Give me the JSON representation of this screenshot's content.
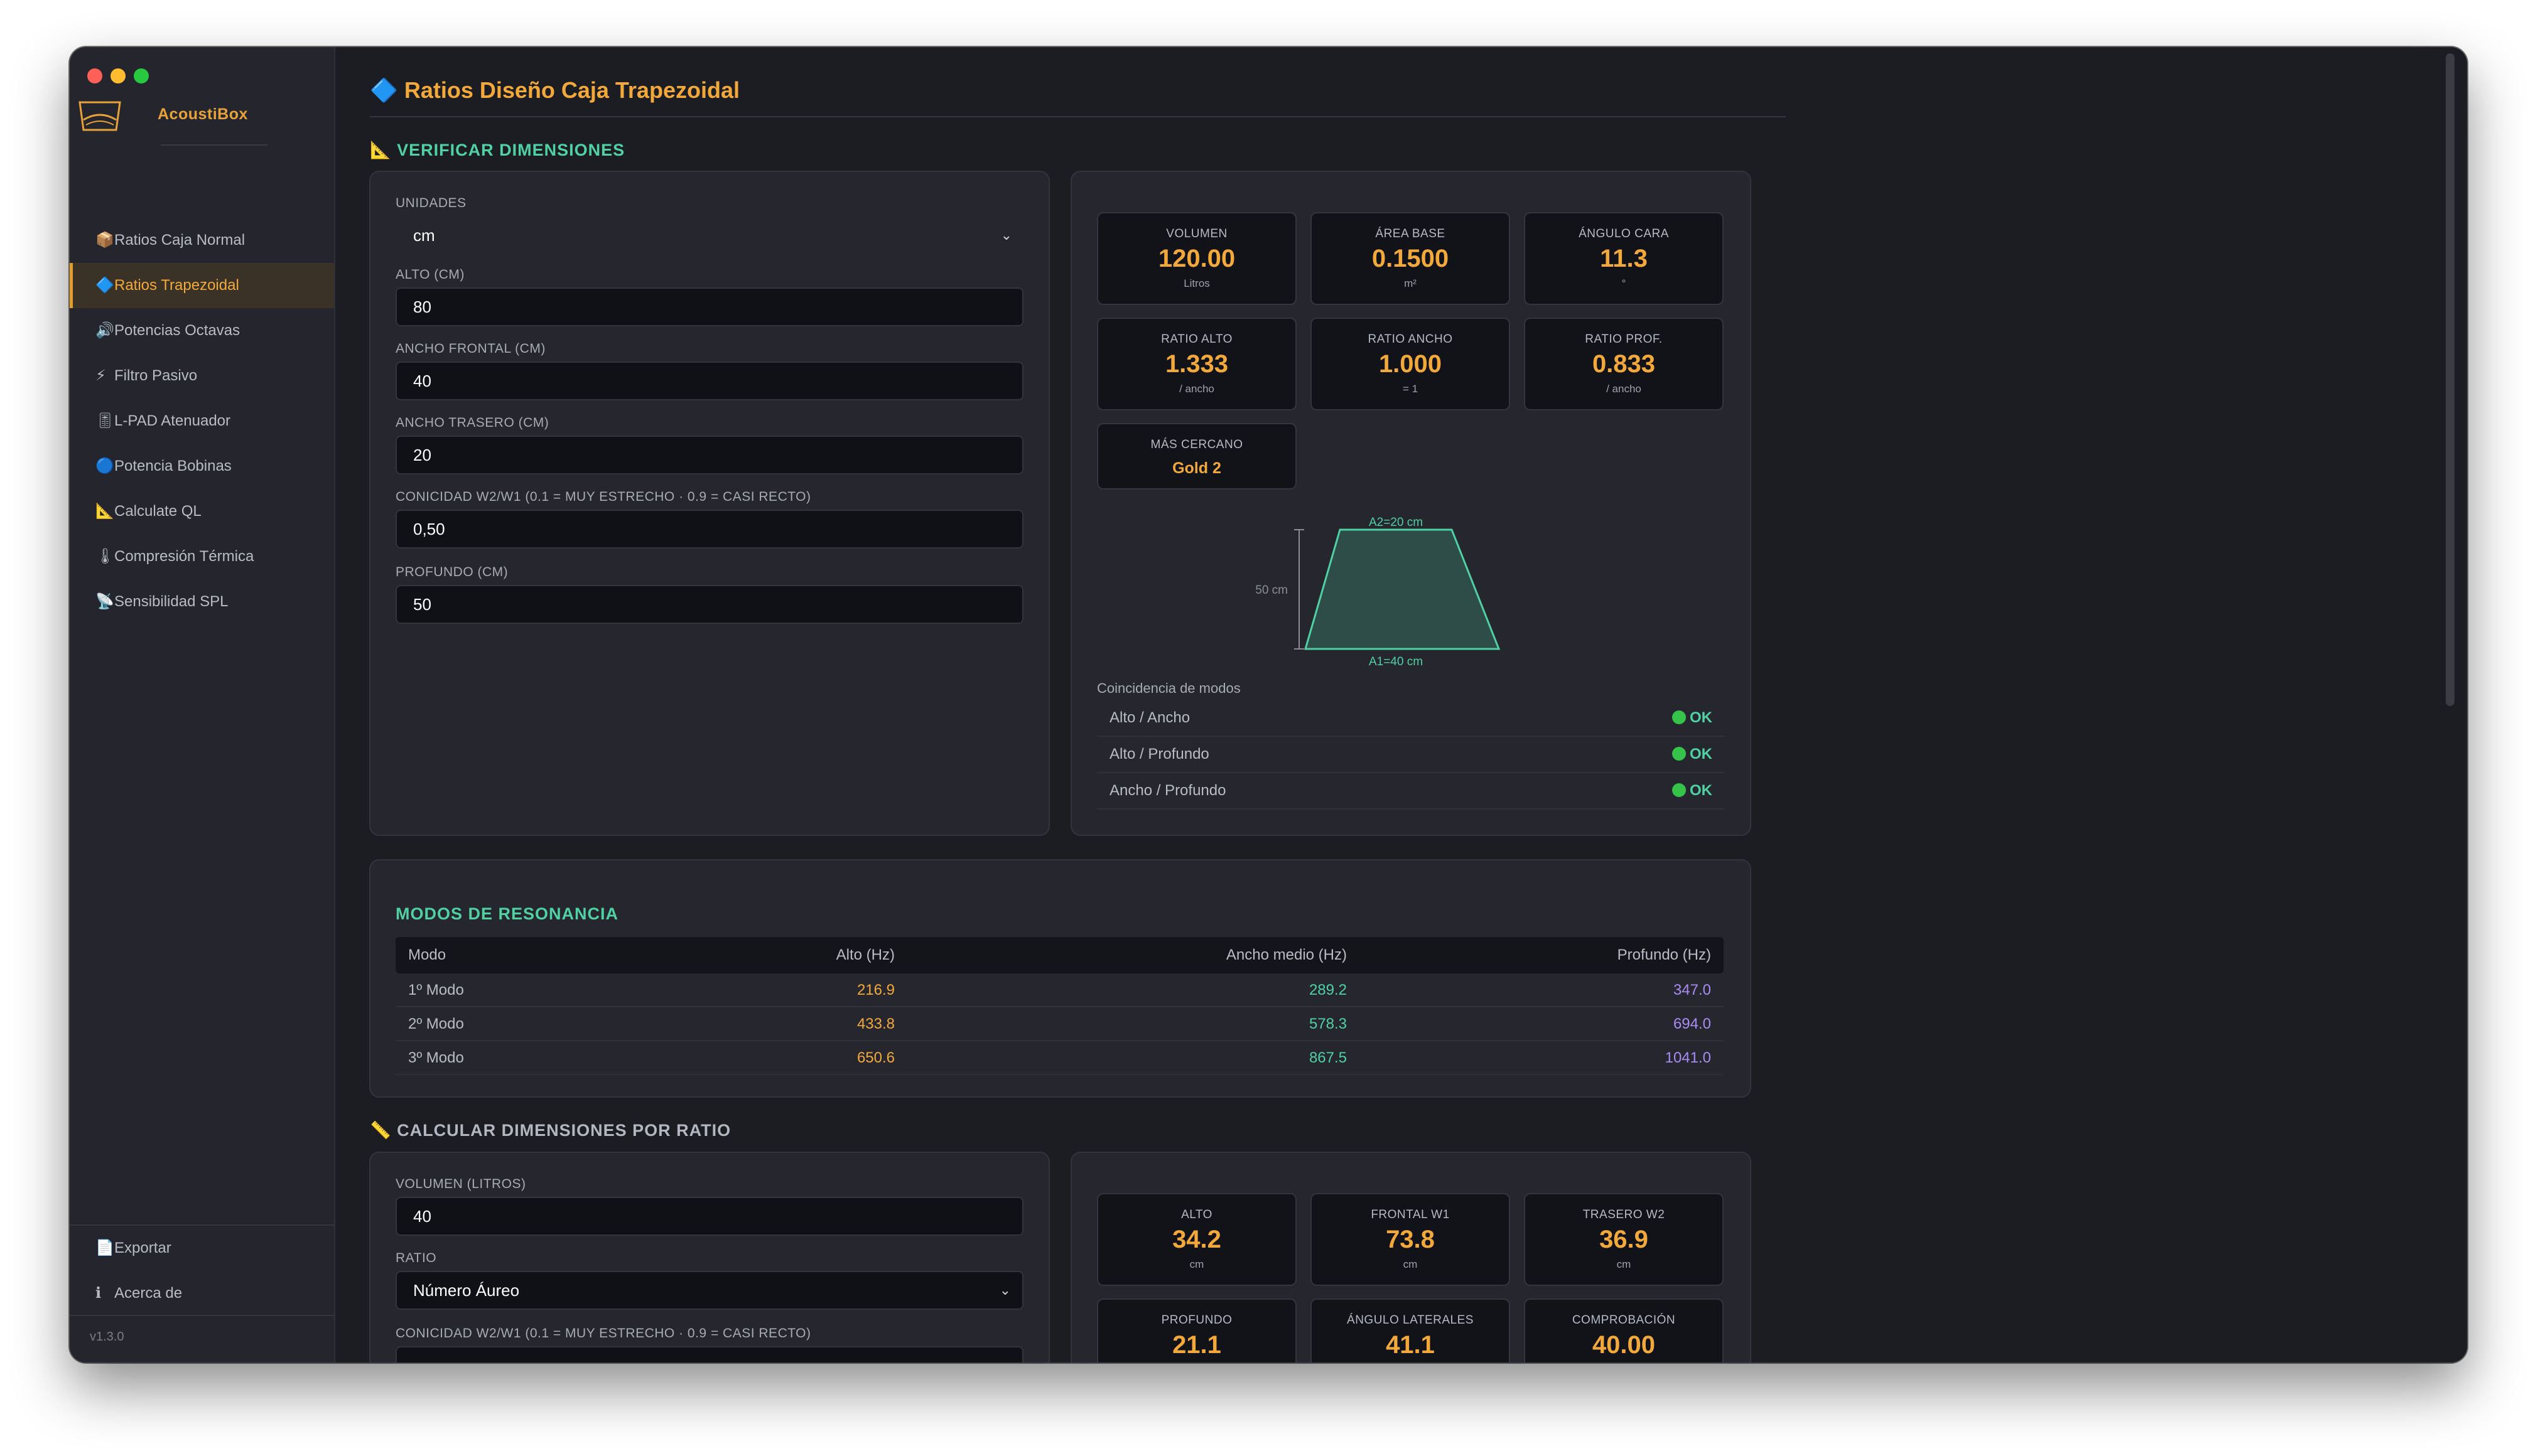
{
  "app": {
    "name": "AcoustiBox",
    "version": "v1.3.0"
  },
  "sidebar": {
    "items": [
      {
        "icon": "📦",
        "label": "Ratios Caja Normal"
      },
      {
        "icon": "🔷",
        "label": "Ratios Trapezoidal"
      },
      {
        "icon": "🔊",
        "label": "Potencias Octavas"
      },
      {
        "icon": "⚡",
        "label": "Filtro Pasivo"
      },
      {
        "icon": "🎚",
        "label": "L-PAD Atenuador"
      },
      {
        "icon": "🔵",
        "label": "Potencia Bobinas"
      },
      {
        "icon": "📐",
        "label": "Calculate QL"
      },
      {
        "icon": "🌡",
        "label": "Compresión Térmica"
      },
      {
        "icon": "📡",
        "label": "Sensibilidad SPL"
      }
    ],
    "bottom": [
      {
        "icon": "📄",
        "label": "Exportar"
      },
      {
        "icon": "ℹ",
        "label": "Acerca de"
      }
    ]
  },
  "page": {
    "title_icon": "🔷",
    "title": "Ratios Diseño Caja Trapezoidal"
  },
  "verify": {
    "icon": "📐",
    "title": "VERIFICAR DIMENSIONES",
    "form": {
      "units_label": "UNIDADES",
      "units_value": "cm",
      "alto_label": "ALTO (CM)",
      "alto_value": "80",
      "ancho_frontal_label": "ANCHO FRONTAL (CM)",
      "ancho_frontal_value": "40",
      "ancho_trasero_label": "ANCHO TRASERO (CM)",
      "ancho_trasero_value": "20",
      "conicidad_label": "CONICIDAD W2/W1 (0.1 = MUY ESTRECHO · 0.9 = CASI RECTO)",
      "conicidad_value": "0,50",
      "profundo_label": "PROFUNDO (CM)",
      "profundo_value": "50"
    },
    "metrics": [
      {
        "label": "VOLUMEN",
        "value": "120.00",
        "unit": "Litros"
      },
      {
        "label": "ÁREA BASE",
        "value": "0.1500",
        "unit": "m²"
      },
      {
        "label": "ÁNGULO CARA",
        "value": "11.3",
        "unit": "°"
      },
      {
        "label": "RATIO ALTO",
        "value": "1.333",
        "unit": "/ ancho"
      },
      {
        "label": "RATIO ANCHO",
        "value": "1.000",
        "unit": "= 1"
      },
      {
        "label": "RATIO PROF.",
        "value": "0.833",
        "unit": "/ ancho"
      }
    ],
    "closest": {
      "label": "MÁS CERCANO",
      "value": "Gold 2"
    },
    "diagram": {
      "top_label": "A2=20 cm",
      "bottom_label": "A1=40 cm",
      "side_label": "50 cm"
    },
    "modes_title": "Coincidencia de modos",
    "checks": [
      {
        "label": "Alto / Ancho",
        "status": "OK"
      },
      {
        "label": "Alto / Profundo",
        "status": "OK"
      },
      {
        "label": "Ancho / Profundo",
        "status": "OK"
      }
    ]
  },
  "resonance": {
    "title": "MODOS DE RESONANCIA",
    "headers": [
      "Modo",
      "Alto (Hz)",
      "Ancho medio (Hz)",
      "Profundo (Hz)"
    ],
    "rows": [
      [
        "1º Modo",
        "216.9",
        "289.2",
        "347.0"
      ],
      [
        "2º Modo",
        "433.8",
        "578.3",
        "694.0"
      ],
      [
        "3º Modo",
        "650.6",
        "867.5",
        "1041.0"
      ]
    ],
    "colors": {
      "alto": "#f3a93a",
      "ancho": "#4fd1a3",
      "profundo": "#a98cf0"
    }
  },
  "calculate": {
    "icon": "📏",
    "title": "CALCULAR DIMENSIONES POR RATIO",
    "form": {
      "volumen_label": "VOLUMEN (LITROS)",
      "volumen_value": "40",
      "ratio_label": "RATIO",
      "ratio_value": "Número Áureo",
      "conicidad_label": "CONICIDAD W2/W1 (0.1 = MUY ESTRECHO · 0.9 = CASI RECTO)"
    },
    "metrics": [
      {
        "label": "ALTO",
        "value": "34.2",
        "unit": "cm"
      },
      {
        "label": "FRONTAL W1",
        "value": "73.8",
        "unit": "cm"
      },
      {
        "label": "TRASERO W2",
        "value": "36.9",
        "unit": "cm"
      },
      {
        "label": "PROFUNDO",
        "value": "21.1",
        "unit": ""
      },
      {
        "label": "ÁNGULO LATERALES",
        "value": "41.1",
        "unit": ""
      },
      {
        "label": "COMPROBACIÓN",
        "value": "40.00",
        "unit": ""
      }
    ]
  }
}
